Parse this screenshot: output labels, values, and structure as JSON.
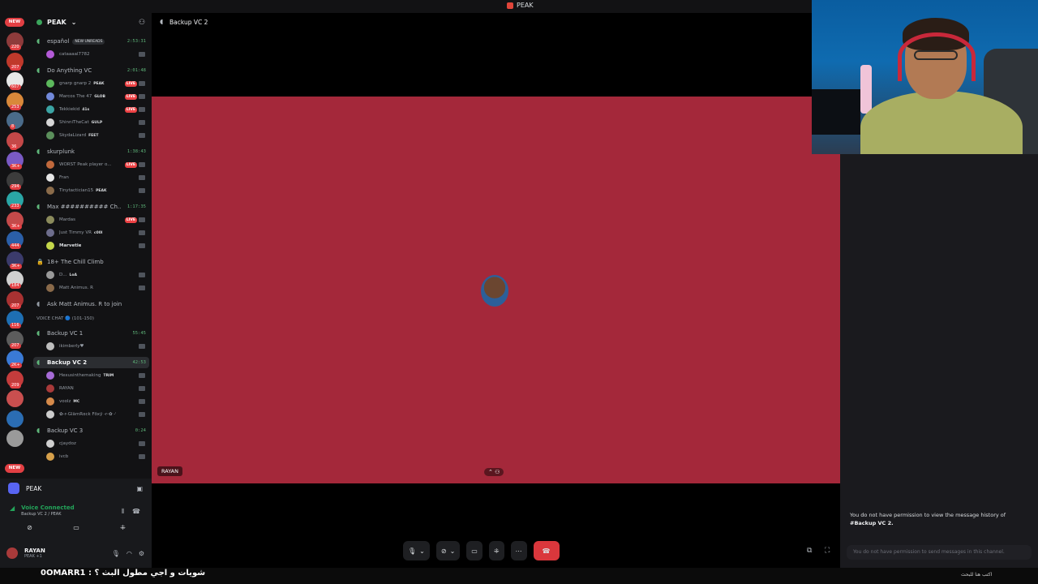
{
  "window": {
    "title": "PEAK"
  },
  "server": {
    "name": "PEAK"
  },
  "server_rail": {
    "badges": [
      "220",
      "207",
      "607",
      "253",
      "8",
      "36",
      "3K+",
      "294",
      "233",
      "3K+",
      "444",
      "3K+",
      "184",
      "207",
      "116",
      "207",
      "2K+",
      "209"
    ],
    "new_label": "NEW"
  },
  "channels": [
    {
      "name": "español",
      "time": "2:53:31",
      "new_unreads": "NEW UNREADS",
      "members": [
        {
          "name": "cataaaal7782",
          "color": "#b35ad6"
        }
      ]
    },
    {
      "name": "Do Anything VC",
      "time": "2:01:48",
      "members": [
        {
          "name": "gnarp gnarp 2",
          "tag": "PEAK",
          "live": "LIVE",
          "color": "#5cb85c"
        },
        {
          "name": "Marcos The 47",
          "tag": "GLOB",
          "live": "LIVE",
          "color": "#7289da"
        },
        {
          "name": "Tekkiekid",
          "tag": "41s",
          "live": "LIVE",
          "color": "#3ba4a4"
        },
        {
          "name": "ShinniTheCat",
          "tag": "GULP",
          "color": "#d6d6d6"
        },
        {
          "name": "SkydaLizard",
          "tag": "FEET",
          "color": "#5b8f5b"
        }
      ]
    },
    {
      "name": "skurplunk",
      "time": "1:38:43",
      "members": [
        {
          "name": "WORST Peak player o...",
          "live": "LIVE",
          "color": "#c1693c"
        },
        {
          "name": "Fran",
          "color": "#e6e6e6"
        },
        {
          "name": "Tinytactician15",
          "tag": "PEAK",
          "color": "#8a6b4a"
        }
      ]
    },
    {
      "name": "Max ########## Ch...",
      "time": "1:17:35",
      "members": [
        {
          "name": "Mardas",
          "live": "LIVE",
          "color": "#8b8b5c"
        },
        {
          "name": "Just Timmy VR",
          "tag": "c00l",
          "color": "#6d6d8c"
        },
        {
          "name": "Marvetie",
          "color": "#c4d64a"
        }
      ]
    },
    {
      "name": "18+ The Chill Climb",
      "locked": true,
      "members": [
        {
          "name": "D...",
          "tag": "LoA",
          "color": "#999999"
        },
        {
          "name": "Matt Animus. R",
          "color": "#8a6a4a"
        }
      ]
    },
    {
      "name": "Ask Matt Animus. R to join",
      "no_time": true,
      "members": []
    },
    {
      "name": "Backup VC 1",
      "time": "55:45",
      "members": [
        {
          "name": "ikimberly♥",
          "color": "#bdbdbd"
        }
      ]
    },
    {
      "name": "Backup VC 2",
      "time": "42:53",
      "active": true,
      "members": [
        {
          "name": "Hexusinthemaking",
          "tag": "TRIM",
          "color": "#a66bd6"
        },
        {
          "name": "RAYAN",
          "color": "#a83a3a"
        },
        {
          "name": "voolz",
          "tag": "MC",
          "color": "#d68a4a"
        },
        {
          "name": "✿-r-GlämRɑck Fōxÿ -r-✿ -%- vicky",
          "color": "#cccccc"
        }
      ]
    },
    {
      "name": "Backup VC 3",
      "time": "0:24",
      "members": [
        {
          "name": "cjaydoz",
          "color": "#cfcfcf"
        },
        {
          "name": "ivcb",
          "color": "#d6a04a"
        }
      ]
    }
  ],
  "category_label": "VOICE CHAT 🔵 (101-150)",
  "user_panel": {
    "guild": "PEAK",
    "voice_status": "Voice Connected",
    "voice_sub": "Backup VC 2 / PEAK",
    "username": "RAYAN",
    "user_sub": "PEAK +1"
  },
  "stage": {
    "channel_title": "Backup VC 2",
    "tile_name": "RAYAN"
  },
  "right_pane": {
    "permission_text": "You do not have permission to view the message history of",
    "permission_channel": "#Backup VC 2.",
    "input_placeholder": "You do not have permission to send messages in this channel."
  },
  "overlay": {
    "bottom_text": "شويات و اجي مطول البث ؟ : 0OMARR1",
    "search_text": "اكتب هنا للبحث"
  },
  "colors": {
    "tile": "#a4283a",
    "end_call": "#da373c",
    "connected": "#23a55a"
  }
}
